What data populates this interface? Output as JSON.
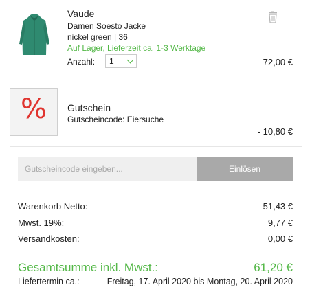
{
  "items": [
    {
      "brand": "Vaude",
      "name": "Damen Soesto Jacke",
      "variant": "nickel green | 36",
      "stock": "Auf Lager, Lieferzeit ca. 1-3 Werktage",
      "qty_label": "Anzahl:",
      "qty_value": "1",
      "price": "72,00 €",
      "image_icon": "green-jacket-image",
      "delete_icon": "trash-icon"
    },
    {
      "title": "Gutschein",
      "code_text": "Gutscheincode: Eiersuche",
      "price": "- 10,80 €",
      "badge_symbol": "%"
    }
  ],
  "coupon_form": {
    "placeholder": "Gutscheincode eingeben...",
    "button_label": "Einlösen"
  },
  "summary": {
    "net_label": "Warenkorb Netto:",
    "net_value": "51,43 €",
    "tax_label": "Mwst. 19%:",
    "tax_value": "9,77 €",
    "shipping_label": "Versandkosten:",
    "shipping_value": "0,00 €",
    "total_label": "Gesamtsumme inkl. Mwst.:",
    "total_value": "61,20 €",
    "delivery_label": "Liefertermin ca.:",
    "delivery_value": "Freitag, 17. April 2020 bis Montag, 20. April 2020"
  },
  "colors": {
    "accent_green": "#54b848",
    "coupon_red": "#e0342f",
    "button_gray": "#a9a9a9",
    "input_bg": "#efefef"
  }
}
